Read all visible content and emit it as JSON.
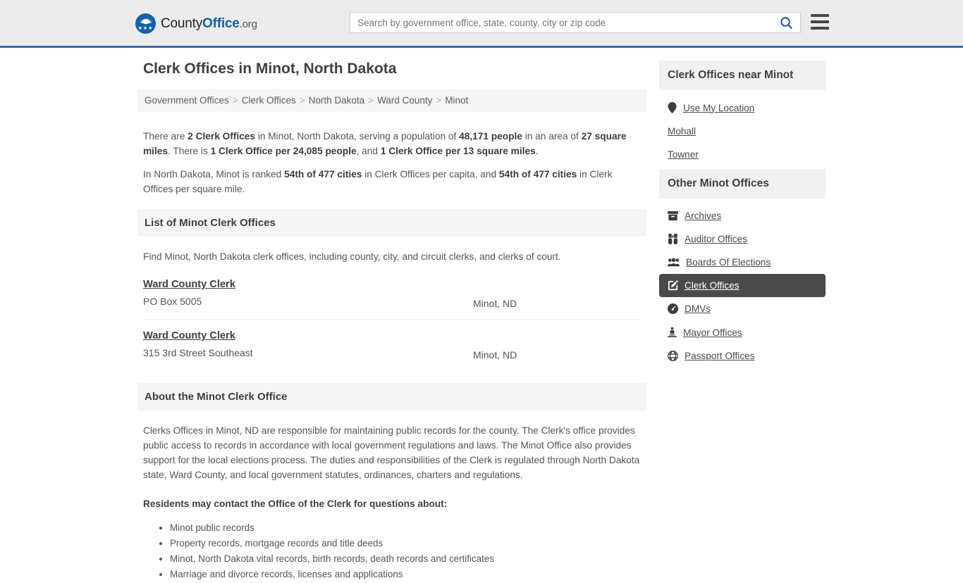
{
  "header": {
    "logo": {
      "name_part1": "County",
      "name_part2": "Office",
      "suffix": ".org",
      "icon": "eagle-seal-icon",
      "stars": "★★★"
    },
    "search": {
      "placeholder": "Search by government office, state, county, city or zip code",
      "value": "",
      "button_icon": "search-icon"
    },
    "menu_icon": "hamburger-menu-icon",
    "accent_color": "#3b6ea5"
  },
  "main": {
    "title": "Clerk Offices in Minot, North Dakota",
    "breadcrumb": [
      {
        "label": "Government Offices"
      },
      {
        "label": "Clerk Offices"
      },
      {
        "label": "North Dakota"
      },
      {
        "label": "Ward County"
      },
      {
        "label": "Minot"
      }
    ],
    "breadcrumb_separator": ">",
    "intro": {
      "p1_a": "There are ",
      "p1_b1": "2 Clerk Offices",
      "p1_b": " in Minot, North Dakota, serving a population of ",
      "p1_b2": "48,171 people",
      "p1_c": " in an area of ",
      "p1_b3": "27 square miles",
      "p1_d": ". There is ",
      "p1_b4": "1 Clerk Office per 24,085 people",
      "p1_e": ", and ",
      "p1_b5": "1 Clerk Office per 13 square miles",
      "p1_f": ".",
      "p2_a": "In North Dakota, Minot is ranked ",
      "p2_b1": "54th of 477 cities",
      "p2_b": " in Clerk Offices per capita, and ",
      "p2_b2": "54th of 477 cities",
      "p2_c": " in Clerk Offices per square mile."
    },
    "list_section": {
      "heading": "List of Minot Clerk Offices",
      "lead": "Find Minot, North Dakota clerk offices, including county, city, and circuit clerks, and clerks of court.",
      "offices": [
        {
          "name": "Ward County Clerk",
          "address": "PO Box 5005",
          "city_state": "Minot, ND"
        },
        {
          "name": "Ward County Clerk",
          "address": "315 3rd Street Southeast",
          "city_state": "Minot, ND"
        }
      ]
    },
    "about_section": {
      "heading": "About the Minot Clerk Office",
      "paragraph": "Clerks Offices in Minot, ND are responsible for maintaining public records for the county. The Clerk's office provides public access to records in accordance with local government regulations and laws. The Minot Office also provides support for the local elections process. The duties and responsibilities of the Clerk is regulated through North Dakota state, Ward County, and local government statutes, ordinances, charters and regulations.",
      "bold_lead": "Residents may contact the Office of the Clerk for questions about:",
      "bullets": [
        "Minot public records",
        "Property records, mortgage records and title deeds",
        "Minot, North Dakota vital records, birth records, death records and certificates",
        "Marriage and divorce records, licenses and applications"
      ]
    }
  },
  "sidebar": {
    "near_section": {
      "heading": "Clerk Offices near Minot",
      "items": [
        {
          "label": "Use My Location",
          "icon": "map-pin-icon",
          "has_icon": true
        },
        {
          "label": "Mohall",
          "icon": "",
          "has_icon": false
        },
        {
          "label": "Towner",
          "icon": "",
          "has_icon": false
        }
      ]
    },
    "other_section": {
      "heading": "Other Minot Offices",
      "active_index": 3,
      "active_bg": "#4a4a4a",
      "items": [
        {
          "label": "Archives",
          "icon": "archive-box-icon"
        },
        {
          "label": "Auditor Offices",
          "icon": "binoculars-icon"
        },
        {
          "label": "Boards Of Elections",
          "icon": "people-group-icon"
        },
        {
          "label": "Clerk Offices",
          "icon": "edit-pencil-square-icon"
        },
        {
          "label": "DMVs",
          "icon": "speedometer-icon"
        },
        {
          "label": "Mayor Offices",
          "icon": "podium-person-icon"
        },
        {
          "label": "Passport Offices",
          "icon": "globe-icon"
        }
      ]
    }
  }
}
